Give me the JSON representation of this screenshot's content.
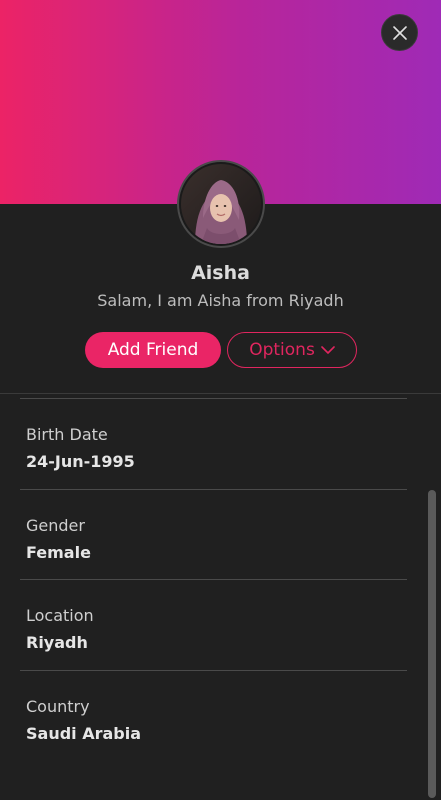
{
  "profile": {
    "name": "Aisha",
    "bio": "Salam, I am Aisha from Riyadh"
  },
  "actions": {
    "add_friend": "Add Friend",
    "options": "Options"
  },
  "details": [
    {
      "label": "Birth Date",
      "value": "24-Jun-1995"
    },
    {
      "label": "Gender",
      "value": "Female"
    },
    {
      "label": "Location",
      "value": "Riyadh"
    },
    {
      "label": "Country",
      "value": "Saudi Arabia"
    }
  ],
  "icons": {
    "close": "close-icon",
    "options_chevron": "chevron-down-icon"
  },
  "colors": {
    "gradient_start": "#ec2366",
    "gradient_end": "#9f2ab6",
    "accent": "#ea2566",
    "background": "#202020"
  }
}
